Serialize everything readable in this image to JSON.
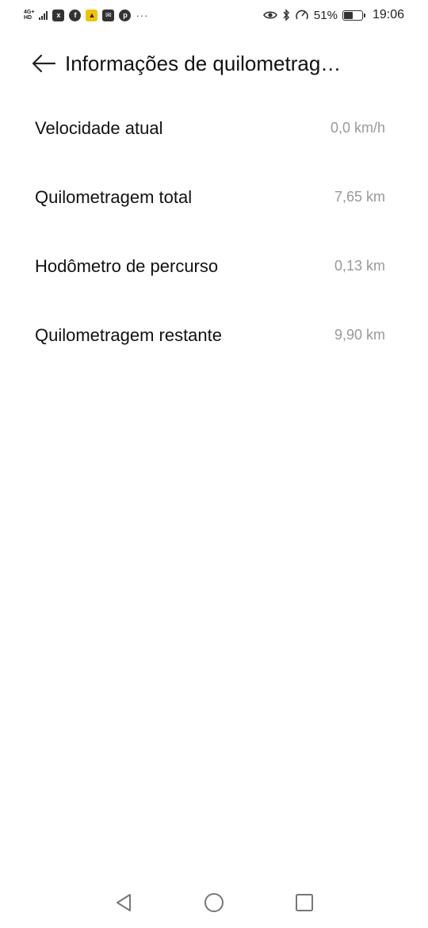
{
  "status_bar": {
    "network_label_top": "4G+",
    "network_label_bottom": "HD",
    "notification_icons": [
      "data-saver-icon",
      "facebook-icon",
      "fire-app-icon",
      "mail-icon",
      "pinterest-icon"
    ],
    "more_indicator": "···",
    "battery_percent": "51%",
    "battery_level": 0.51,
    "time": "19:06"
  },
  "header": {
    "title": "Informações de quilometrag…"
  },
  "mileage_items": [
    {
      "label": "Velocidade atual",
      "value": "0,0 km/h"
    },
    {
      "label": "Quilometragem total",
      "value": "7,65 km"
    },
    {
      "label": "Hodômetro de percurso",
      "value": "0,13 km"
    },
    {
      "label": "Quilometragem restante",
      "value": "9,90 km"
    }
  ],
  "colors": {
    "background": "#ffffff",
    "primary_text": "#111111",
    "secondary_text": "#999999"
  }
}
